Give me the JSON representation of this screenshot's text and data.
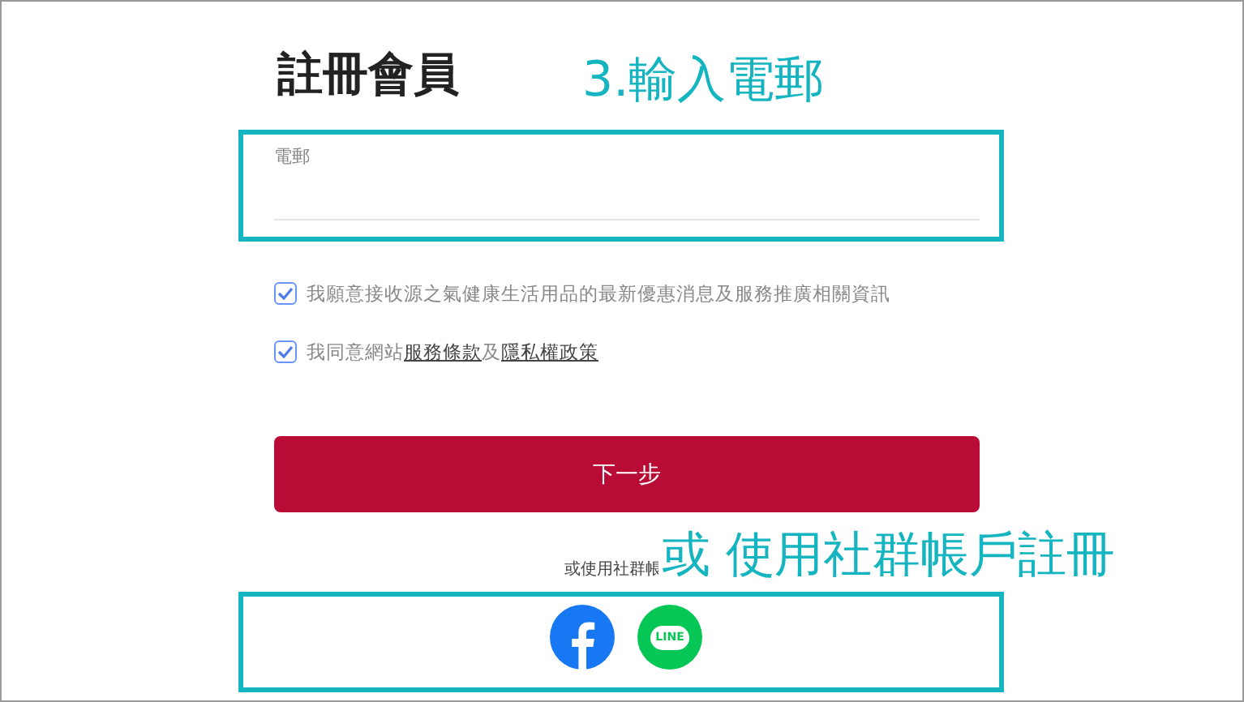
{
  "title": "註冊會員",
  "email_field": {
    "label": "電郵"
  },
  "consents": [
    {
      "kind": "plain",
      "checked": true,
      "text": "我願意接收源之氣健康生活用品的最新優惠消息及服務推廣相關資訊"
    },
    {
      "kind": "links",
      "checked": true,
      "text": "我同意網站",
      "link_1": "服務條款",
      "joiner": "及",
      "link_2": "隱私權政策"
    }
  ],
  "next_button": "下一步",
  "social_label": "或使用社群帳",
  "social": [
    {
      "kind": "facebook"
    },
    {
      "kind": "line",
      "text": "LINE"
    }
  ],
  "annotations": [
    {
      "text": "3.輸入電郵"
    },
    {
      "text": "或 使用社群帳戶註冊"
    }
  ]
}
